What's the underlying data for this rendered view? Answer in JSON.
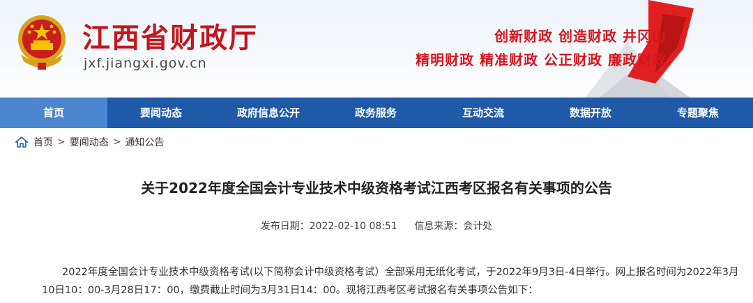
{
  "header": {
    "site_title": "江西省财政厅",
    "site_url": "jxf.jiangxi.gov.cn",
    "slogan_line1": "创新财政 创造财政 井冈山",
    "slogan_line2": "精明财政 精准财政 公正财政 廉政财政"
  },
  "nav": {
    "items": [
      {
        "label": "首页"
      },
      {
        "label": "要闻动态"
      },
      {
        "label": "政府信息公开"
      },
      {
        "label": "政务服务"
      },
      {
        "label": "互动交流"
      },
      {
        "label": "数据开放"
      },
      {
        "label": "专题聚焦"
      }
    ],
    "active_index": 0
  },
  "breadcrumb": {
    "items": [
      "首页",
      "要闻动态",
      "通知公告"
    ],
    "separator": ">"
  },
  "article": {
    "title": "关于2022年度全国会计专业技术中级资格考试江西考区报名有关事项的公告",
    "publish_date_label": "发布日期：2022-02-10 08:51",
    "source_label": "信息来源：会计处",
    "body": "2022年度全国会计专业技术中级资格考试(以下简称会计中级资格考试）全部采用无纸化考试，于2022年9月3日-4日举行。网上报名时间为2022年3月10日10：00-3月28日17：00，缴费截止时间为3月31日14：00。现将江西考区考试报名有关事项公告如下："
  },
  "colors": {
    "brand_red": "#c4161c",
    "nav_blue": "#1e5aa8",
    "nav_active": "#4c86cf"
  },
  "icons": {
    "emblem": "national-emblem-icon",
    "home": "home-icon"
  }
}
